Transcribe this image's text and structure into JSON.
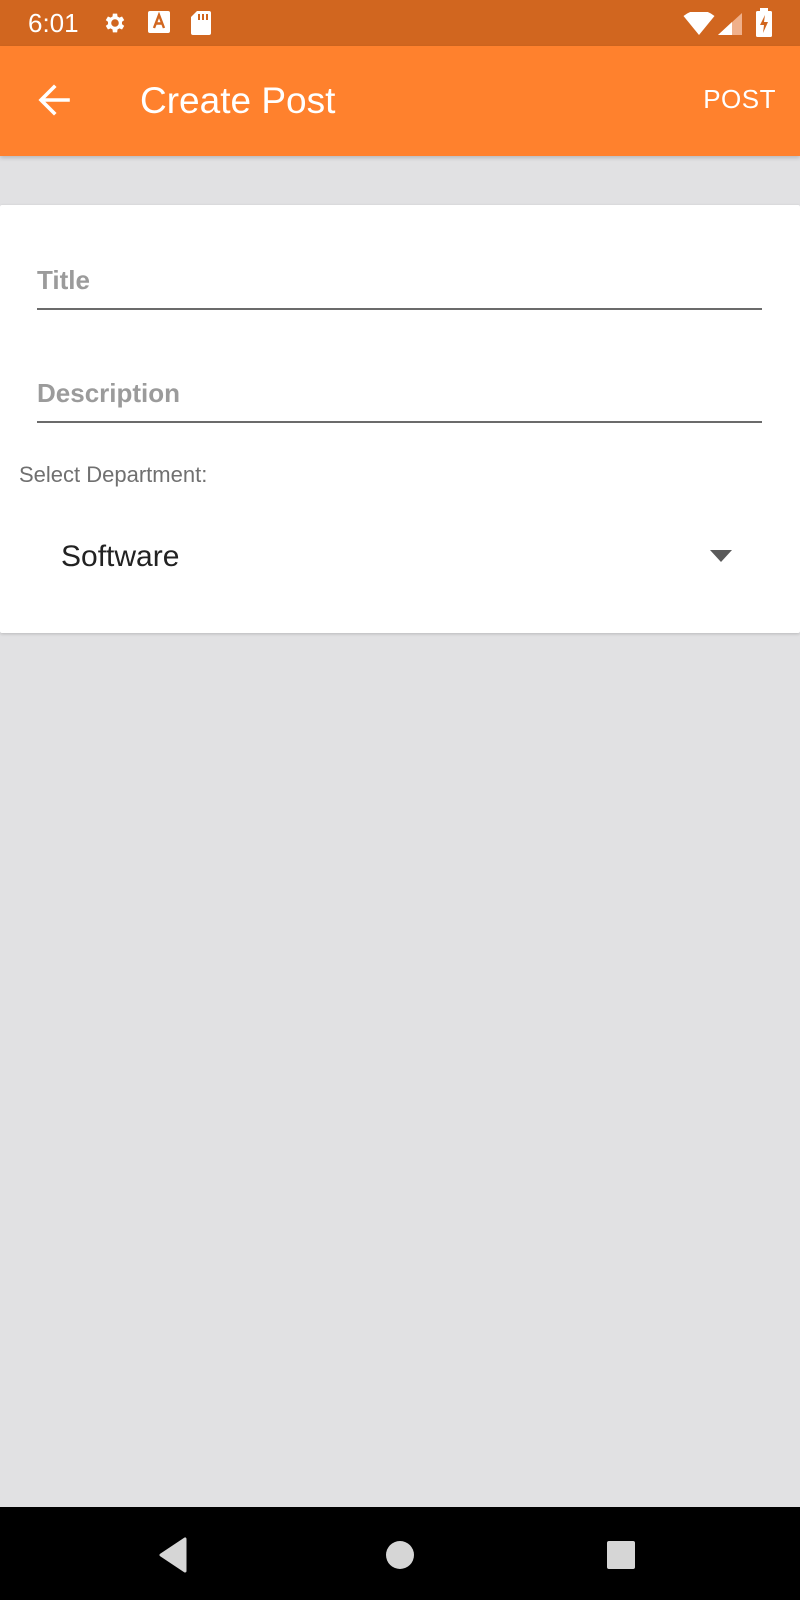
{
  "status_bar": {
    "time": "6:01",
    "icons": [
      "gear-icon",
      "a-badge-icon",
      "sd-card-icon",
      "wifi-icon",
      "signal-icon",
      "battery-charging-icon"
    ]
  },
  "app_bar": {
    "back_icon": "arrow-left-icon",
    "title": "Create Post",
    "action_label": "POST"
  },
  "form": {
    "title_placeholder": "Title",
    "description_placeholder": "Description",
    "department_label": "Select Department:",
    "department_value": "Software"
  },
  "nav_bar": {
    "buttons": [
      "back-triangle-icon",
      "home-circle-icon",
      "recents-square-icon"
    ]
  },
  "colors": {
    "status_bar": "#d1661f",
    "app_bar": "#ff812d",
    "background": "#e1e1e3",
    "card": "#ffffff"
  }
}
